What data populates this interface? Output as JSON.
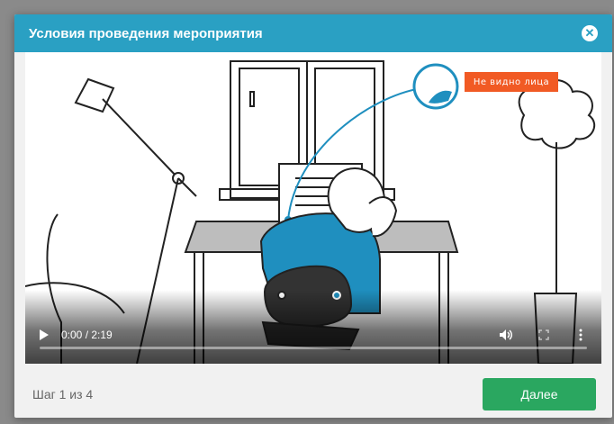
{
  "modal": {
    "title": "Условия проведения мероприятия",
    "close_icon": "close-icon"
  },
  "video": {
    "annotation": "Не видно лица",
    "time": "0:00 / 2:19",
    "progress": 0,
    "icons": {
      "play": "play-icon",
      "volume": "volume-icon",
      "fullscreen": "fullscreen-icon",
      "more": "more-options-icon"
    }
  },
  "footer": {
    "step": "Шаг 1 из 4",
    "next_label": "Далее"
  },
  "colors": {
    "header": "#2aa0c3",
    "next_button": "#2aa760",
    "annotation": "#f15a24",
    "illustration_blue": "#1f8fbf"
  }
}
